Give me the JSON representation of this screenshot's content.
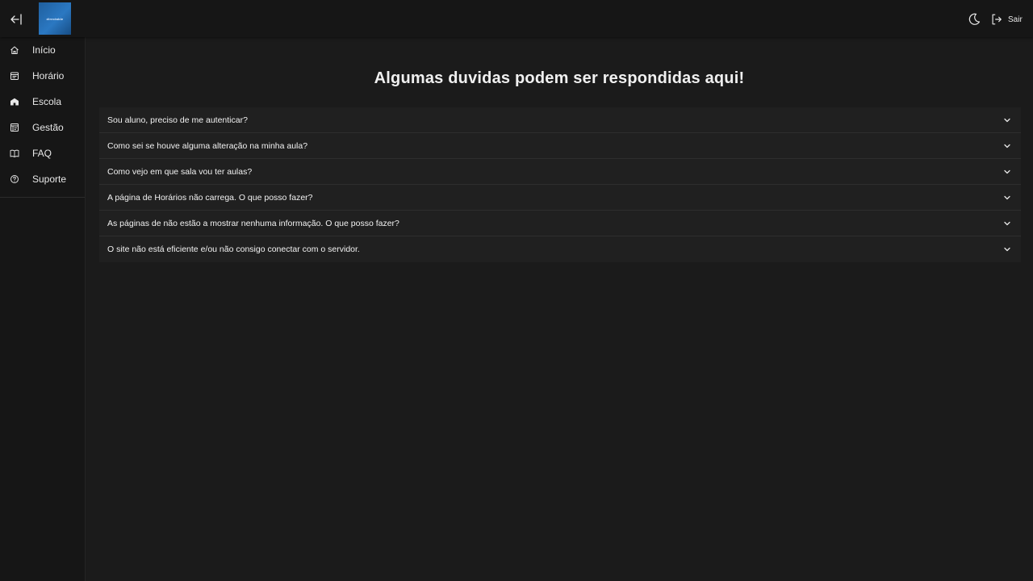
{
  "header": {
    "logo_text": "directable",
    "logout_label": "Sair",
    "icons": {
      "collapse": "arrow-left-bar-icon",
      "theme": "moon-icon",
      "logout": "logout-icon"
    }
  },
  "sidebar": {
    "items": [
      {
        "label": "Início",
        "icon": "home-icon"
      },
      {
        "label": "Horário",
        "icon": "calendar-icon"
      },
      {
        "label": "Escola",
        "icon": "school-icon"
      },
      {
        "label": "Gestão",
        "icon": "management-icon"
      },
      {
        "label": "FAQ",
        "icon": "book-icon"
      },
      {
        "label": "Suporte",
        "icon": "help-icon"
      }
    ]
  },
  "main": {
    "title": "Algumas duvidas podem ser respondidas aqui!",
    "faq": [
      {
        "question": "Sou aluno, preciso de me autenticar?"
      },
      {
        "question": "Como sei se houve alguma alteração na minha aula?"
      },
      {
        "question": "Como vejo em que sala vou ter aulas?"
      },
      {
        "question": "A página de Horários não carrega. O que posso fazer?"
      },
      {
        "question": "As páginas de não estão a mostrar nenhuma informação. O que posso fazer?"
      },
      {
        "question": "O site não está eficiente e/ou não consigo conectar com o servidor."
      }
    ]
  },
  "colors": {
    "background": "#1b1b1b",
    "sidebar": "#161616",
    "faq_item": "#202020",
    "logo": "#2b78c2"
  }
}
